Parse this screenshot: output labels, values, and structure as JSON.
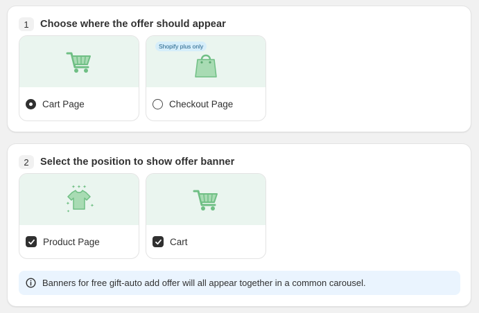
{
  "section1": {
    "number": "1",
    "title": "Choose where the offer should appear",
    "options": [
      {
        "label": "Cart Page",
        "selected": true,
        "icon": "cart-icon"
      },
      {
        "label": "Checkout Page",
        "selected": false,
        "icon": "shopping-bag-icon",
        "badge": "Shopify plus only"
      }
    ]
  },
  "section2": {
    "number": "2",
    "title": "Select the position to show offer banner",
    "options": [
      {
        "label": "Product Page",
        "checked": true,
        "icon": "tshirt-icon"
      },
      {
        "label": "Cart",
        "checked": true,
        "icon": "cart-icon"
      }
    ],
    "info_text": "Banners for free gift-auto add offer will all appear together in a common carousel."
  },
  "colors": {
    "illustration_bg": "#eaf5ef",
    "illustration_green": "#8fcf9f",
    "info_bg": "#eaf4fe",
    "badge_bg": "#d6eefa"
  }
}
